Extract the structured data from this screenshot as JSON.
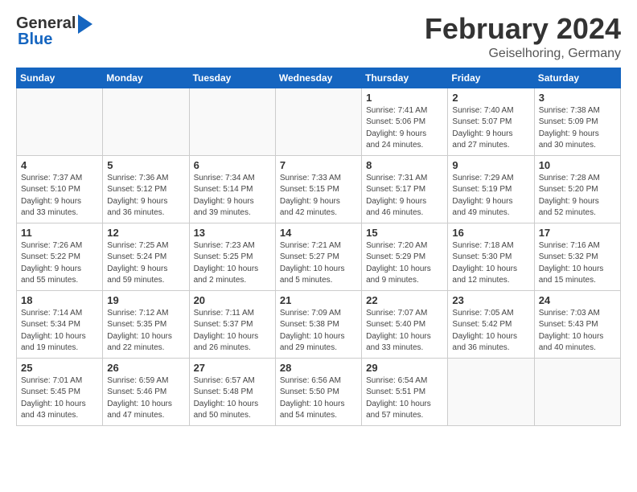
{
  "header": {
    "logo_general": "General",
    "logo_blue": "Blue",
    "title": "February 2024",
    "subtitle": "Geiselhoring, Germany"
  },
  "calendar": {
    "days_of_week": [
      "Sunday",
      "Monday",
      "Tuesday",
      "Wednesday",
      "Thursday",
      "Friday",
      "Saturday"
    ],
    "weeks": [
      [
        {
          "day": "",
          "info": ""
        },
        {
          "day": "",
          "info": ""
        },
        {
          "day": "",
          "info": ""
        },
        {
          "day": "",
          "info": ""
        },
        {
          "day": "1",
          "info": "Sunrise: 7:41 AM\nSunset: 5:06 PM\nDaylight: 9 hours\nand 24 minutes."
        },
        {
          "day": "2",
          "info": "Sunrise: 7:40 AM\nSunset: 5:07 PM\nDaylight: 9 hours\nand 27 minutes."
        },
        {
          "day": "3",
          "info": "Sunrise: 7:38 AM\nSunset: 5:09 PM\nDaylight: 9 hours\nand 30 minutes."
        }
      ],
      [
        {
          "day": "4",
          "info": "Sunrise: 7:37 AM\nSunset: 5:10 PM\nDaylight: 9 hours\nand 33 minutes."
        },
        {
          "day": "5",
          "info": "Sunrise: 7:36 AM\nSunset: 5:12 PM\nDaylight: 9 hours\nand 36 minutes."
        },
        {
          "day": "6",
          "info": "Sunrise: 7:34 AM\nSunset: 5:14 PM\nDaylight: 9 hours\nand 39 minutes."
        },
        {
          "day": "7",
          "info": "Sunrise: 7:33 AM\nSunset: 5:15 PM\nDaylight: 9 hours\nand 42 minutes."
        },
        {
          "day": "8",
          "info": "Sunrise: 7:31 AM\nSunset: 5:17 PM\nDaylight: 9 hours\nand 46 minutes."
        },
        {
          "day": "9",
          "info": "Sunrise: 7:29 AM\nSunset: 5:19 PM\nDaylight: 9 hours\nand 49 minutes."
        },
        {
          "day": "10",
          "info": "Sunrise: 7:28 AM\nSunset: 5:20 PM\nDaylight: 9 hours\nand 52 minutes."
        }
      ],
      [
        {
          "day": "11",
          "info": "Sunrise: 7:26 AM\nSunset: 5:22 PM\nDaylight: 9 hours\nand 55 minutes."
        },
        {
          "day": "12",
          "info": "Sunrise: 7:25 AM\nSunset: 5:24 PM\nDaylight: 9 hours\nand 59 minutes."
        },
        {
          "day": "13",
          "info": "Sunrise: 7:23 AM\nSunset: 5:25 PM\nDaylight: 10 hours\nand 2 minutes."
        },
        {
          "day": "14",
          "info": "Sunrise: 7:21 AM\nSunset: 5:27 PM\nDaylight: 10 hours\nand 5 minutes."
        },
        {
          "day": "15",
          "info": "Sunrise: 7:20 AM\nSunset: 5:29 PM\nDaylight: 10 hours\nand 9 minutes."
        },
        {
          "day": "16",
          "info": "Sunrise: 7:18 AM\nSunset: 5:30 PM\nDaylight: 10 hours\nand 12 minutes."
        },
        {
          "day": "17",
          "info": "Sunrise: 7:16 AM\nSunset: 5:32 PM\nDaylight: 10 hours\nand 15 minutes."
        }
      ],
      [
        {
          "day": "18",
          "info": "Sunrise: 7:14 AM\nSunset: 5:34 PM\nDaylight: 10 hours\nand 19 minutes."
        },
        {
          "day": "19",
          "info": "Sunrise: 7:12 AM\nSunset: 5:35 PM\nDaylight: 10 hours\nand 22 minutes."
        },
        {
          "day": "20",
          "info": "Sunrise: 7:11 AM\nSunset: 5:37 PM\nDaylight: 10 hours\nand 26 minutes."
        },
        {
          "day": "21",
          "info": "Sunrise: 7:09 AM\nSunset: 5:38 PM\nDaylight: 10 hours\nand 29 minutes."
        },
        {
          "day": "22",
          "info": "Sunrise: 7:07 AM\nSunset: 5:40 PM\nDaylight: 10 hours\nand 33 minutes."
        },
        {
          "day": "23",
          "info": "Sunrise: 7:05 AM\nSunset: 5:42 PM\nDaylight: 10 hours\nand 36 minutes."
        },
        {
          "day": "24",
          "info": "Sunrise: 7:03 AM\nSunset: 5:43 PM\nDaylight: 10 hours\nand 40 minutes."
        }
      ],
      [
        {
          "day": "25",
          "info": "Sunrise: 7:01 AM\nSunset: 5:45 PM\nDaylight: 10 hours\nand 43 minutes."
        },
        {
          "day": "26",
          "info": "Sunrise: 6:59 AM\nSunset: 5:46 PM\nDaylight: 10 hours\nand 47 minutes."
        },
        {
          "day": "27",
          "info": "Sunrise: 6:57 AM\nSunset: 5:48 PM\nDaylight: 10 hours\nand 50 minutes."
        },
        {
          "day": "28",
          "info": "Sunrise: 6:56 AM\nSunset: 5:50 PM\nDaylight: 10 hours\nand 54 minutes."
        },
        {
          "day": "29",
          "info": "Sunrise: 6:54 AM\nSunset: 5:51 PM\nDaylight: 10 hours\nand 57 minutes."
        },
        {
          "day": "",
          "info": ""
        },
        {
          "day": "",
          "info": ""
        }
      ]
    ]
  }
}
